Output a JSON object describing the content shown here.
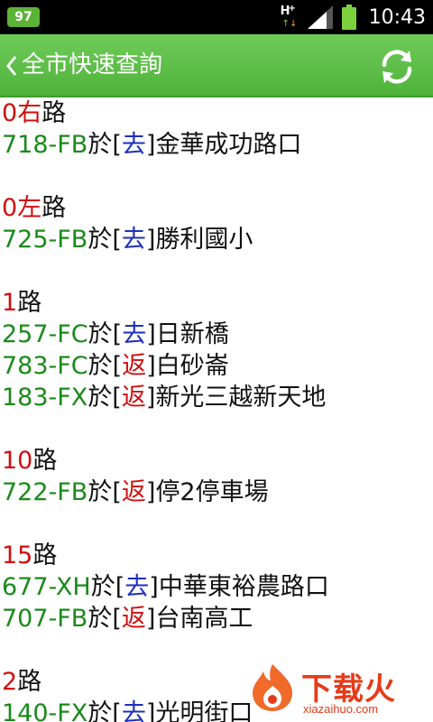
{
  "status_bar": {
    "badge": "97",
    "network_type": "H",
    "time": "10:43",
    "icons": [
      "notification-badge",
      "network-h-icon",
      "signal-icon",
      "battery-icon"
    ]
  },
  "title_bar": {
    "title": "全市快速查詢",
    "back_icon": "chevron-left-icon",
    "refresh_icon": "refresh-icon"
  },
  "colors": {
    "route_number": "#d10f0f",
    "bus_id": "#1a8a1a",
    "dir_go": "#1c2fbf",
    "dir_back": "#d10f0f",
    "title_bar": "#5cbf47"
  },
  "routes": [
    {
      "num": "0",
      "dir": "右",
      "lu": "路",
      "stops": [
        {
          "bus": "718-FB",
          "at": "於[",
          "dir": "去",
          "close": "]",
          "place": "金華成功路口",
          "dir_type": "go"
        }
      ]
    },
    {
      "num": "0",
      "dir": "左",
      "lu": "路",
      "stops": [
        {
          "bus": "725-FB",
          "at": "於[",
          "dir": "去",
          "close": "]",
          "place": "勝利國小",
          "dir_type": "go"
        }
      ]
    },
    {
      "num": "1",
      "dir": "",
      "lu": "路",
      "stops": [
        {
          "bus": "257-FC",
          "at": "於[",
          "dir": "去",
          "close": "]",
          "place": "日新橋",
          "dir_type": "go"
        },
        {
          "bus": "783-FC",
          "at": "於[",
          "dir": "返",
          "close": "]",
          "place": "白砂崙",
          "dir_type": "back"
        },
        {
          "bus": "183-FX",
          "at": "於[",
          "dir": "返",
          "close": "]",
          "place": "新光三越新天地",
          "dir_type": "back"
        }
      ]
    },
    {
      "num": "10",
      "dir": "",
      "lu": "路",
      "stops": [
        {
          "bus": "722-FB",
          "at": "於[",
          "dir": "返",
          "close": "]",
          "place": "停2停車場",
          "dir_type": "back"
        }
      ]
    },
    {
      "num": "15",
      "dir": "",
      "lu": "路",
      "stops": [
        {
          "bus": "677-XH",
          "at": "於[",
          "dir": "去",
          "close": "]",
          "place": "中華東裕農路口",
          "dir_type": "go"
        },
        {
          "bus": "707-FB",
          "at": "於[",
          "dir": "返",
          "close": "]",
          "place": "台南高工",
          "dir_type": "back"
        }
      ]
    },
    {
      "num": "2",
      "dir": "",
      "lu": "路",
      "stops": [
        {
          "bus": "140-FX",
          "at": "於[",
          "dir": "去",
          "close": "]",
          "place": "光明街口",
          "dir_type": "go"
        }
      ]
    }
  ],
  "watermark": {
    "title": "下载火",
    "subtitle": "xiazaihuo.com"
  }
}
